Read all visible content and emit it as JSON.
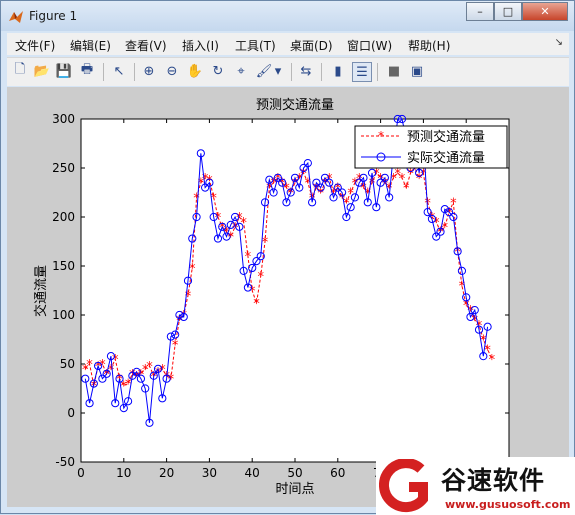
{
  "window": {
    "title": "Figure 1",
    "minimize": "–",
    "maximize": "□",
    "close": "✕"
  },
  "menu": [
    "文件(F)",
    "编辑(E)",
    "查看(V)",
    "插入(I)",
    "工具(T)",
    "桌面(D)",
    "窗口(W)",
    "帮助(H)"
  ],
  "menu_pin": "↘",
  "toolbar": [
    {
      "name": "new-icon",
      "glyph": "🗋"
    },
    {
      "name": "open-icon",
      "glyph": "📂"
    },
    {
      "name": "save-icon",
      "glyph": "💾"
    },
    {
      "name": "print-icon",
      "glyph": "🖶"
    },
    {
      "name": "select-arrow-icon",
      "glyph": "↖"
    },
    {
      "name": "zoom-in-icon",
      "glyph": "⊕"
    },
    {
      "name": "zoom-out-icon",
      "glyph": "⊖"
    },
    {
      "name": "pan-hand-icon",
      "glyph": "✋"
    },
    {
      "name": "rotate-icon",
      "glyph": "↻"
    },
    {
      "name": "data-cursor-icon",
      "glyph": "⌖"
    },
    {
      "name": "brush-icon",
      "glyph": "🖌"
    },
    {
      "name": "brush-dropdown-icon",
      "glyph": "▾"
    },
    {
      "name": "link-icon",
      "glyph": "⇆"
    },
    {
      "name": "colorbar-icon",
      "glyph": "▮"
    },
    {
      "name": "legend-icon",
      "glyph": "☰"
    },
    {
      "name": "hide-tools-icon",
      "glyph": "■"
    },
    {
      "name": "show-tools-icon",
      "glyph": "▣"
    }
  ],
  "watermark": {
    "text": "谷速软件",
    "url": "www.gusuosoft.com",
    "logo_letter": "G"
  },
  "chart_data": {
    "type": "line",
    "title": "预测交通流量",
    "xlabel": "时间点",
    "ylabel": "交通流量",
    "xlim": [
      0,
      100
    ],
    "ylim": [
      -50,
      300
    ],
    "xticks": [
      0,
      10,
      20,
      30,
      40,
      50,
      60,
      70,
      80,
      90,
      100
    ],
    "yticks": [
      -50,
      0,
      50,
      100,
      150,
      200,
      250,
      300
    ],
    "grid": false,
    "legend_position": "top-right",
    "colors": {
      "predicted": "#ff0000",
      "actual": "#0000ff"
    },
    "x": [
      1,
      2,
      3,
      4,
      5,
      6,
      7,
      8,
      9,
      10,
      11,
      12,
      13,
      14,
      15,
      16,
      17,
      18,
      19,
      20,
      21,
      22,
      23,
      24,
      25,
      26,
      27,
      28,
      29,
      30,
      31,
      32,
      33,
      34,
      35,
      36,
      37,
      38,
      39,
      40,
      41,
      42,
      43,
      44,
      45,
      46,
      47,
      48,
      49,
      50,
      51,
      52,
      53,
      54,
      55,
      56,
      57,
      58,
      59,
      60,
      61,
      62,
      63,
      64,
      65,
      66,
      67,
      68,
      69,
      70,
      71,
      72,
      73,
      74,
      75,
      76,
      77,
      78,
      79,
      80,
      81,
      82,
      83,
      84,
      85,
      86,
      87,
      88,
      89,
      90,
      91,
      92,
      93,
      94,
      95,
      96
    ],
    "series": [
      {
        "name": "预测交通流量",
        "style": "red-dashed-star",
        "values": [
          45,
          50,
          28,
          48,
          50,
          40,
          45,
          55,
          35,
          28,
          30,
          40,
          38,
          40,
          45,
          48,
          38,
          42,
          45,
          38,
          35,
          70,
          95,
          100,
          120,
          148,
          220,
          235,
          240,
          238,
          220,
          200,
          190,
          185,
          180,
          190,
          200,
          195,
          160,
          125,
          112,
          140,
          175,
          230,
          235,
          240,
          235,
          230,
          225,
          235,
          240,
          245,
          235,
          220,
          230,
          225,
          235,
          240,
          225,
          230,
          220,
          215,
          225,
          235,
          240,
          230,
          225,
          235,
          245,
          240,
          235,
          230,
          240,
          245,
          240,
          230,
          245,
          250,
          240,
          245,
          215,
          200,
          195,
          185,
          190,
          205,
          215,
          165,
          130,
          110,
          105,
          95,
          90,
          75,
          65,
          55
        ]
      },
      {
        "name": "实际交通流量",
        "style": "blue-solid-circle",
        "values": [
          35,
          10,
          30,
          48,
          35,
          40,
          58,
          10,
          35,
          5,
          12,
          38,
          42,
          35,
          25,
          -10,
          38,
          45,
          15,
          35,
          78,
          80,
          100,
          98,
          135,
          178,
          200,
          265,
          230,
          235,
          200,
          178,
          190,
          180,
          192,
          200,
          190,
          145,
          128,
          148,
          155,
          160,
          215,
          238,
          225,
          240,
          235,
          215,
          225,
          240,
          230,
          250,
          255,
          215,
          235,
          230,
          240,
          235,
          220,
          230,
          225,
          200,
          210,
          220,
          235,
          240,
          215,
          245,
          210,
          235,
          240,
          220,
          265,
          300,
          300,
          280,
          250,
          275,
          245,
          280,
          205,
          198,
          180,
          185,
          208,
          205,
          200,
          165,
          145,
          118,
          98,
          105,
          85,
          58,
          88
        ]
      }
    ]
  }
}
